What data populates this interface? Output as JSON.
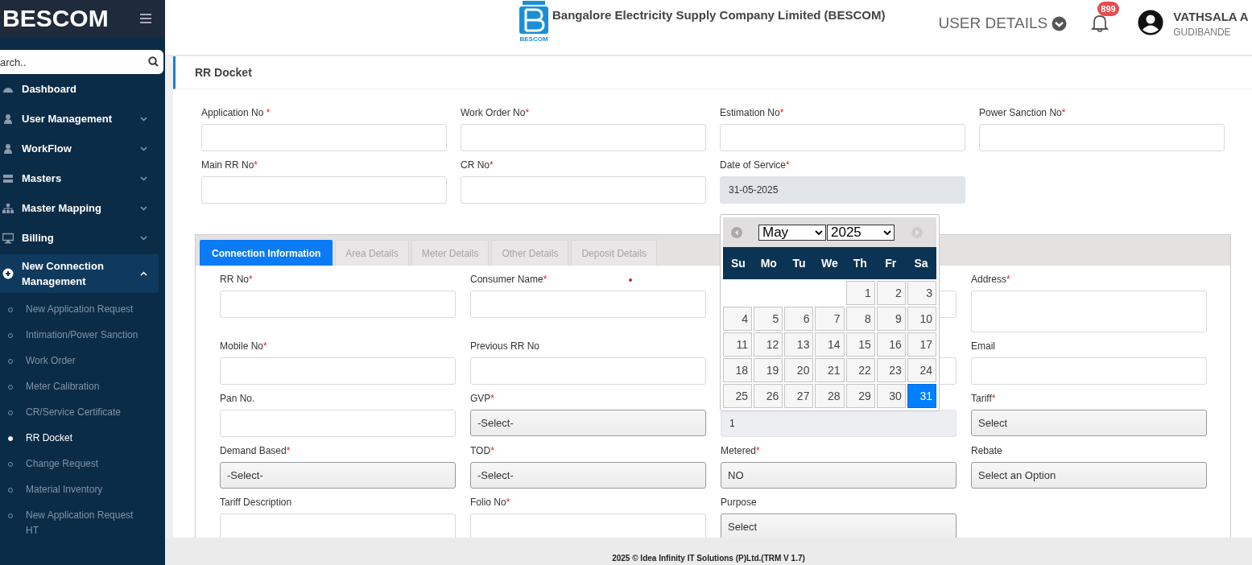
{
  "sidebar": {
    "brand": "BESCOM",
    "search": {
      "placeholder": "arch.."
    },
    "items": [
      {
        "label": "Dashboard",
        "kind": "link"
      },
      {
        "label": "User Management",
        "kind": "group",
        "expanded": false
      },
      {
        "label": "WorkFlow",
        "kind": "group",
        "expanded": false
      },
      {
        "label": "Masters",
        "kind": "group",
        "expanded": false
      },
      {
        "label": "Master Mapping",
        "kind": "group",
        "expanded": false
      },
      {
        "label": "Billing",
        "kind": "group",
        "expanded": false
      },
      {
        "label": "New Connection Management",
        "kind": "group",
        "expanded": true,
        "children": [
          {
            "label": "New Application Request",
            "selected": false
          },
          {
            "label": "Intimation/Power Sanction",
            "selected": false
          },
          {
            "label": "Work Order",
            "selected": false
          },
          {
            "label": "Meter Calibration",
            "selected": false
          },
          {
            "label": "CR/Service Certificate",
            "selected": false
          },
          {
            "label": "RR Docket",
            "selected": true
          },
          {
            "label": "Change Request",
            "selected": false
          },
          {
            "label": "Material Inventory",
            "selected": false
          },
          {
            "label": "New Application Request HT",
            "selected": false
          }
        ]
      }
    ]
  },
  "header": {
    "company": "Bangalore Electricity Supply Company Limited (BESCOM)",
    "logo_caption": "BESCOM",
    "user_details": "USER DETAILS",
    "notification_count": "899",
    "user_name": "VATHSALA A",
    "user_location": "GUDIBANDE"
  },
  "page_title": "RR Docket",
  "top_form": [
    {
      "label": "Application No ",
      "required_mark": "*",
      "disabled": false
    },
    {
      "label": "Work Order No",
      "required_mark": "*",
      "disabled": false
    },
    {
      "label": "Estimation No",
      "required_mark": "*",
      "disabled": false
    },
    {
      "label": "Power Sanction No",
      "required_mark": "*",
      "disabled": false
    },
    {
      "label": "Main RR No",
      "required_mark": "*",
      "disabled": false
    },
    {
      "label": "CR No",
      "required_mark": "*",
      "disabled": false
    },
    {
      "label": "Date of Service",
      "required_mark": "*",
      "disabled": true,
      "value": "31-05-2025"
    }
  ],
  "tabs": [
    {
      "label": "Connection Information",
      "selected": true
    },
    {
      "label": "Area Details",
      "selected": false
    },
    {
      "label": "Meter Details",
      "selected": false
    },
    {
      "label": "Other Details",
      "selected": false
    },
    {
      "label": "Deposit Details",
      "selected": false
    }
  ],
  "tab_form": [
    {
      "label": "RR No",
      "required_mark": "*",
      "kind": "input",
      "disabled": false
    },
    {
      "label": "Consumer Name",
      "required_mark": "*",
      "kind": "input",
      "disabled": false,
      "error_dot": true
    },
    {
      "kind": "input",
      "disabled": false
    },
    {
      "label": "Address",
      "required_mark": "*",
      "kind": "textarea"
    },
    {
      "label": "Mobile No",
      "required_mark": "*",
      "kind": "input",
      "disabled": false
    },
    {
      "label": "Previous RR No",
      "kind": "input",
      "disabled": false
    },
    {
      "kind": "input",
      "disabled": false
    },
    {
      "label": "Email",
      "kind": "input",
      "disabled": false
    },
    {
      "label": "Pan No.",
      "kind": "input",
      "disabled": false
    },
    {
      "label": "GVP",
      "required_mark": "*",
      "kind": "select",
      "value": "-Select-"
    },
    {
      "kind": "input",
      "disabled": true,
      "value": "1"
    },
    {
      "label": "Tariff",
      "required_mark": "*",
      "kind": "select",
      "value": "Select"
    },
    {
      "label": "Demand Based",
      "required_mark": "*",
      "kind": "select",
      "value": "-Select-"
    },
    {
      "label": "TOD",
      "required_mark": "*",
      "kind": "select",
      "value": "-Select-"
    },
    {
      "label": "Metered",
      "required_mark": "*",
      "kind": "select",
      "value": "NO"
    },
    {
      "label": "Rebate",
      "kind": "select",
      "value": "Select an Option"
    },
    {
      "label": "Tariff Description",
      "kind": "input",
      "disabled": false
    },
    {
      "label": "Folio No",
      "required_mark": "*",
      "kind": "input",
      "disabled": false
    },
    {
      "label": "Purpose",
      "kind": "select",
      "value": "Select"
    }
  ],
  "calendar": {
    "month": "May",
    "year": "2025",
    "weekdays": [
      "Su",
      "Mo",
      "Tu",
      "We",
      "Th",
      "Fr",
      "Sa"
    ],
    "weeks": [
      [
        {
          "kind": "blank"
        },
        {
          "kind": "blank"
        },
        {
          "kind": "blank"
        },
        {
          "kind": "blank"
        },
        {
          "kind": "day",
          "day": "1",
          "selected": false
        },
        {
          "kind": "day",
          "day": "2",
          "selected": false
        },
        {
          "kind": "day",
          "day": "3",
          "selected": false
        }
      ],
      [
        {
          "kind": "day",
          "day": "4",
          "selected": false
        },
        {
          "kind": "day",
          "day": "5",
          "selected": false
        },
        {
          "kind": "day",
          "day": "6",
          "selected": false
        },
        {
          "kind": "day",
          "day": "7",
          "selected": false
        },
        {
          "kind": "day",
          "day": "8",
          "selected": false
        },
        {
          "kind": "day",
          "day": "9",
          "selected": false
        },
        {
          "kind": "day",
          "day": "10",
          "selected": false
        }
      ],
      [
        {
          "kind": "day",
          "day": "11",
          "selected": false
        },
        {
          "kind": "day",
          "day": "12",
          "selected": false
        },
        {
          "kind": "day",
          "day": "13",
          "selected": false
        },
        {
          "kind": "day",
          "day": "14",
          "selected": false
        },
        {
          "kind": "day",
          "day": "15",
          "selected": false
        },
        {
          "kind": "day",
          "day": "16",
          "selected": false
        },
        {
          "kind": "day",
          "day": "17",
          "selected": false
        }
      ],
      [
        {
          "kind": "day",
          "day": "18",
          "selected": false
        },
        {
          "kind": "day",
          "day": "19",
          "selected": false
        },
        {
          "kind": "day",
          "day": "20",
          "selected": false
        },
        {
          "kind": "day",
          "day": "21",
          "selected": false
        },
        {
          "kind": "day",
          "day": "22",
          "selected": false
        },
        {
          "kind": "day",
          "day": "23",
          "selected": false
        },
        {
          "kind": "day",
          "day": "24",
          "selected": false
        }
      ],
      [
        {
          "kind": "day",
          "day": "25",
          "selected": false
        },
        {
          "kind": "day",
          "day": "26",
          "selected": false
        },
        {
          "kind": "day",
          "day": "27",
          "selected": false
        },
        {
          "kind": "day",
          "day": "28",
          "selected": false
        },
        {
          "kind": "day",
          "day": "29",
          "selected": false
        },
        {
          "kind": "day",
          "day": "30",
          "selected": false
        },
        {
          "kind": "day",
          "day": "31",
          "selected": true
        }
      ]
    ]
  },
  "footer": "2025 © Idea Infinity IT Solutions (P)Ltd.(TRM V 1.7)"
}
